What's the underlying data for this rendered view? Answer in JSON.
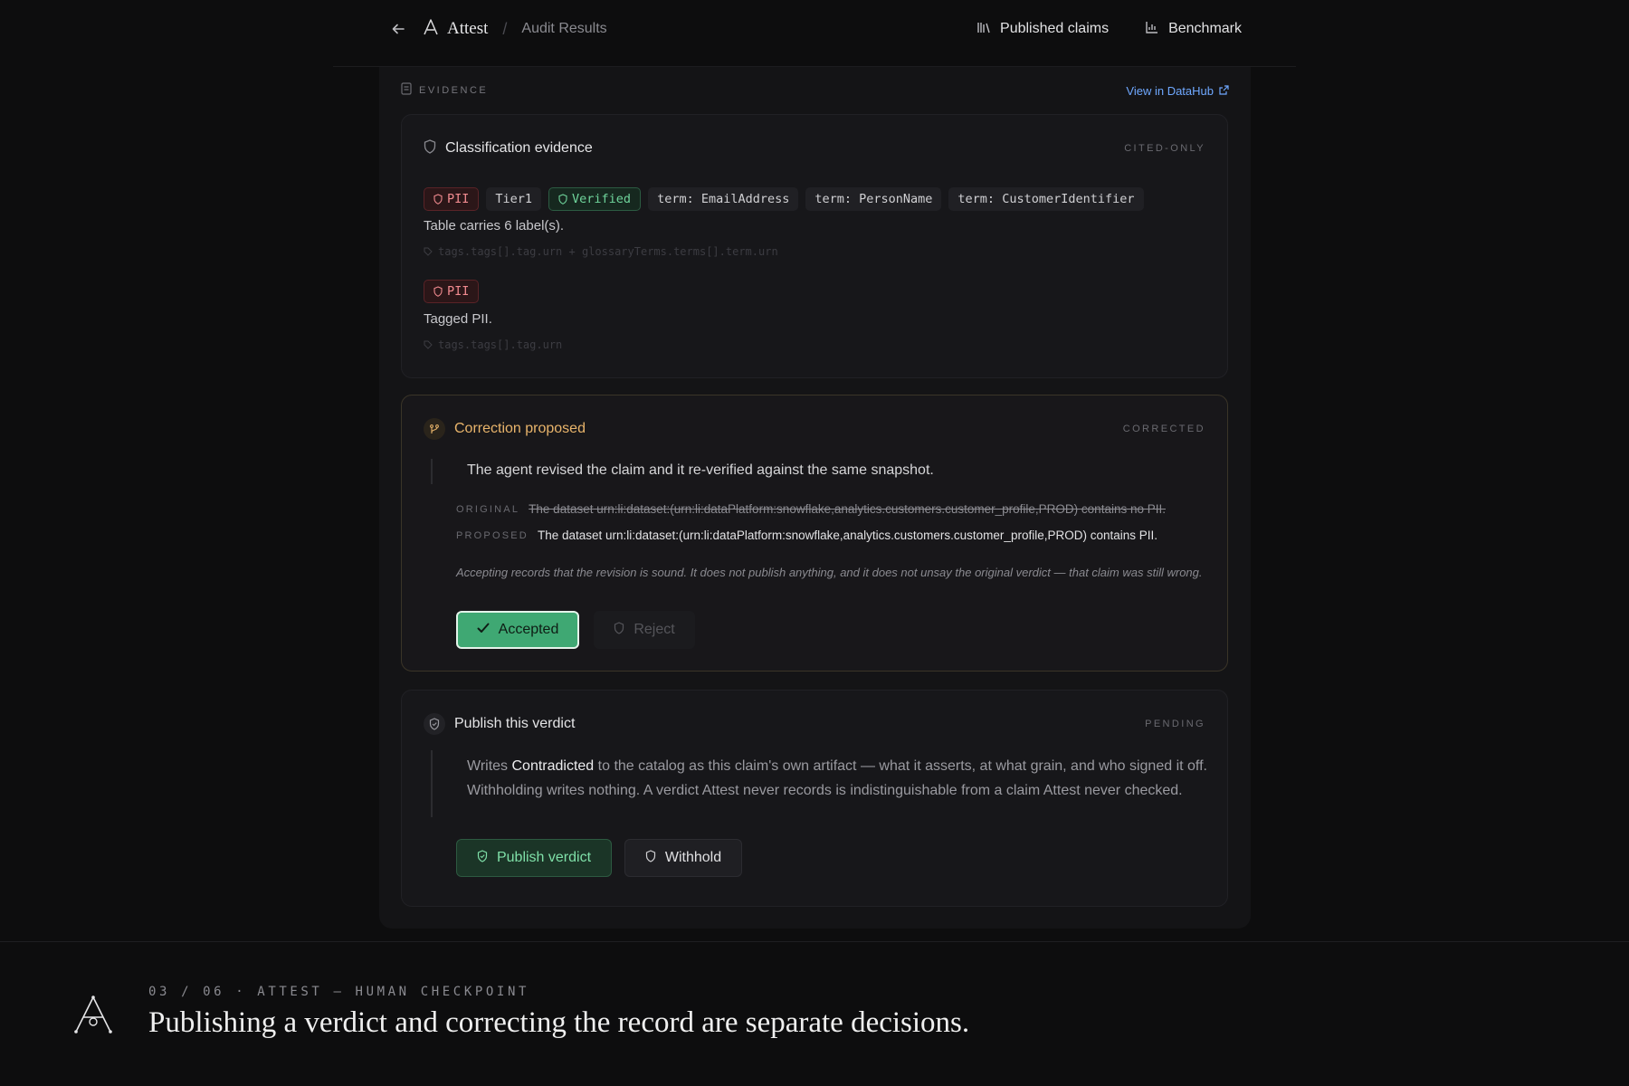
{
  "nav": {
    "brand": "Attest",
    "breadcrumb": "Audit Results",
    "published_claims": "Published claims",
    "benchmark": "Benchmark"
  },
  "evidence": {
    "label": "EVIDENCE",
    "datahub_link": "View in DataHub"
  },
  "classification": {
    "title": "Classification evidence",
    "status": "CITED-ONLY",
    "tags": [
      "PII",
      "Tier1",
      "Verified",
      "term: EmailAddress",
      "term: PersonName",
      "term: CustomerIdentifier"
    ],
    "summary": "Table carries 6 label(s).",
    "path1": "tags.tags[].tag.urn + glossaryTerms.terms[].term.urn",
    "tag2": "PII",
    "summary2": "Tagged PII.",
    "path2": "tags.tags[].tag.urn"
  },
  "correction": {
    "title": "Correction proposed",
    "status": "CORRECTED",
    "quote": "The agent revised the claim and it re-verified against the same snapshot.",
    "original_key": "ORIGINAL",
    "original_val": "The dataset urn:li:dataset:(urn:li:dataPlatform:snowflake,analytics.customers.customer_profile,PROD) contains no PII.",
    "proposed_key": "PROPOSED",
    "proposed_val": "The dataset urn:li:dataset:(urn:li:dataPlatform:snowflake,analytics.customers.customer_profile,PROD) contains PII.",
    "note": "Accepting records that the revision is sound. It does not publish anything, and it does not unsay the original verdict — that claim was still wrong.",
    "accepted_label": "Accepted",
    "reject_label": "Reject"
  },
  "publish": {
    "title": "Publish this verdict",
    "status": "PENDING",
    "text_before": "Writes ",
    "text_bold": "Contradicted",
    "text_after": " to the catalog as this claim's own artifact — what it asserts, at what grain, and who signed it off. Withholding writes nothing. A verdict Attest never records is indistinguishable from a claim Attest never checked.",
    "publish_label": "Publish verdict",
    "withhold_label": "Withhold"
  },
  "footer": {
    "kicker": "03 / 06 · ATTEST — HUMAN CHECKPOINT",
    "headline": "Publishing a verdict and correcting the record are separate decisions."
  },
  "colors": {
    "background": "#0d0d0e",
    "accent_green": "#3fa873",
    "accent_amber": "#e8b46b",
    "pii_red": "#f08a8f",
    "link_blue": "#6fa8ff"
  }
}
